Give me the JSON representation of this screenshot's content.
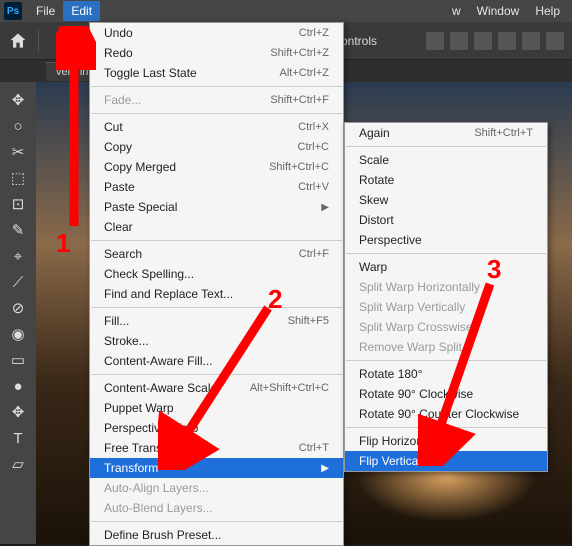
{
  "menubar": {
    "items": [
      "File",
      "Edit"
    ],
    "open_index": 1,
    "rest": [
      "w",
      "Window",
      "Help"
    ]
  },
  "optbar": {
    "label": "m Controls"
  },
  "tabs": {
    "items": [
      "velorin.p"
    ]
  },
  "edit_menu": [
    {
      "t": "item",
      "label": "Undo",
      "shortcut": "Ctrl+Z"
    },
    {
      "t": "item",
      "label": "Redo",
      "shortcut": "Shift+Ctrl+Z"
    },
    {
      "t": "item",
      "label": "Toggle Last State",
      "shortcut": "Alt+Ctrl+Z"
    },
    {
      "t": "sep"
    },
    {
      "t": "item",
      "label": "Fade...",
      "shortcut": "Shift+Ctrl+F",
      "disabled": true
    },
    {
      "t": "sep"
    },
    {
      "t": "item",
      "label": "Cut",
      "shortcut": "Ctrl+X"
    },
    {
      "t": "item",
      "label": "Copy",
      "shortcut": "Ctrl+C"
    },
    {
      "t": "item",
      "label": "Copy Merged",
      "shortcut": "Shift+Ctrl+C"
    },
    {
      "t": "item",
      "label": "Paste",
      "shortcut": "Ctrl+V"
    },
    {
      "t": "item",
      "label": "Paste Special",
      "submenu": true
    },
    {
      "t": "item",
      "label": "Clear"
    },
    {
      "t": "sep"
    },
    {
      "t": "item",
      "label": "Search",
      "shortcut": "Ctrl+F"
    },
    {
      "t": "item",
      "label": "Check Spelling..."
    },
    {
      "t": "item",
      "label": "Find and Replace Text..."
    },
    {
      "t": "sep"
    },
    {
      "t": "item",
      "label": "Fill...",
      "shortcut": "Shift+F5"
    },
    {
      "t": "item",
      "label": "Stroke..."
    },
    {
      "t": "item",
      "label": "Content-Aware Fill..."
    },
    {
      "t": "sep"
    },
    {
      "t": "item",
      "label": "Content-Aware Scale",
      "shortcut": "Alt+Shift+Ctrl+C"
    },
    {
      "t": "item",
      "label": "Puppet Warp"
    },
    {
      "t": "item",
      "label": "Perspective Warp"
    },
    {
      "t": "item",
      "label": "Free Transform",
      "shortcut": "Ctrl+T"
    },
    {
      "t": "item",
      "label": "Transform",
      "submenu": true,
      "highlight": true
    },
    {
      "t": "item",
      "label": "Auto-Align Layers...",
      "disabled": true
    },
    {
      "t": "item",
      "label": "Auto-Blend Layers...",
      "disabled": true
    },
    {
      "t": "sep"
    },
    {
      "t": "item",
      "label": "Define Brush Preset..."
    }
  ],
  "transform_menu": [
    {
      "t": "item",
      "label": "Again",
      "shortcut": "Shift+Ctrl+T"
    },
    {
      "t": "sep"
    },
    {
      "t": "item",
      "label": "Scale"
    },
    {
      "t": "item",
      "label": "Rotate"
    },
    {
      "t": "item",
      "label": "Skew"
    },
    {
      "t": "item",
      "label": "Distort"
    },
    {
      "t": "item",
      "label": "Perspective"
    },
    {
      "t": "sep"
    },
    {
      "t": "item",
      "label": "Warp"
    },
    {
      "t": "item",
      "label": "Split Warp Horizontally",
      "disabled": true
    },
    {
      "t": "item",
      "label": "Split Warp Vertically",
      "disabled": true
    },
    {
      "t": "item",
      "label": "Split Warp Crosswise",
      "disabled": true
    },
    {
      "t": "item",
      "label": "Remove Warp Split",
      "disabled": true
    },
    {
      "t": "sep"
    },
    {
      "t": "item",
      "label": "Rotate 180°"
    },
    {
      "t": "item",
      "label": "Rotate 90° Clockwise"
    },
    {
      "t": "item",
      "label": "Rotate 90° Counter Clockwise"
    },
    {
      "t": "sep"
    },
    {
      "t": "item",
      "label": "Flip Horizontal"
    },
    {
      "t": "item",
      "label": "Flip Vertical",
      "highlight": true
    }
  ],
  "tools": [
    "✥",
    "○",
    "✂",
    "⬚",
    "⊡",
    "✎",
    "⌖",
    "⟋",
    "⊘",
    "◉",
    "▭",
    "●",
    "✥",
    "T",
    "▱"
  ],
  "annotations": {
    "a1": "1",
    "a2": "2",
    "a3": "3"
  }
}
